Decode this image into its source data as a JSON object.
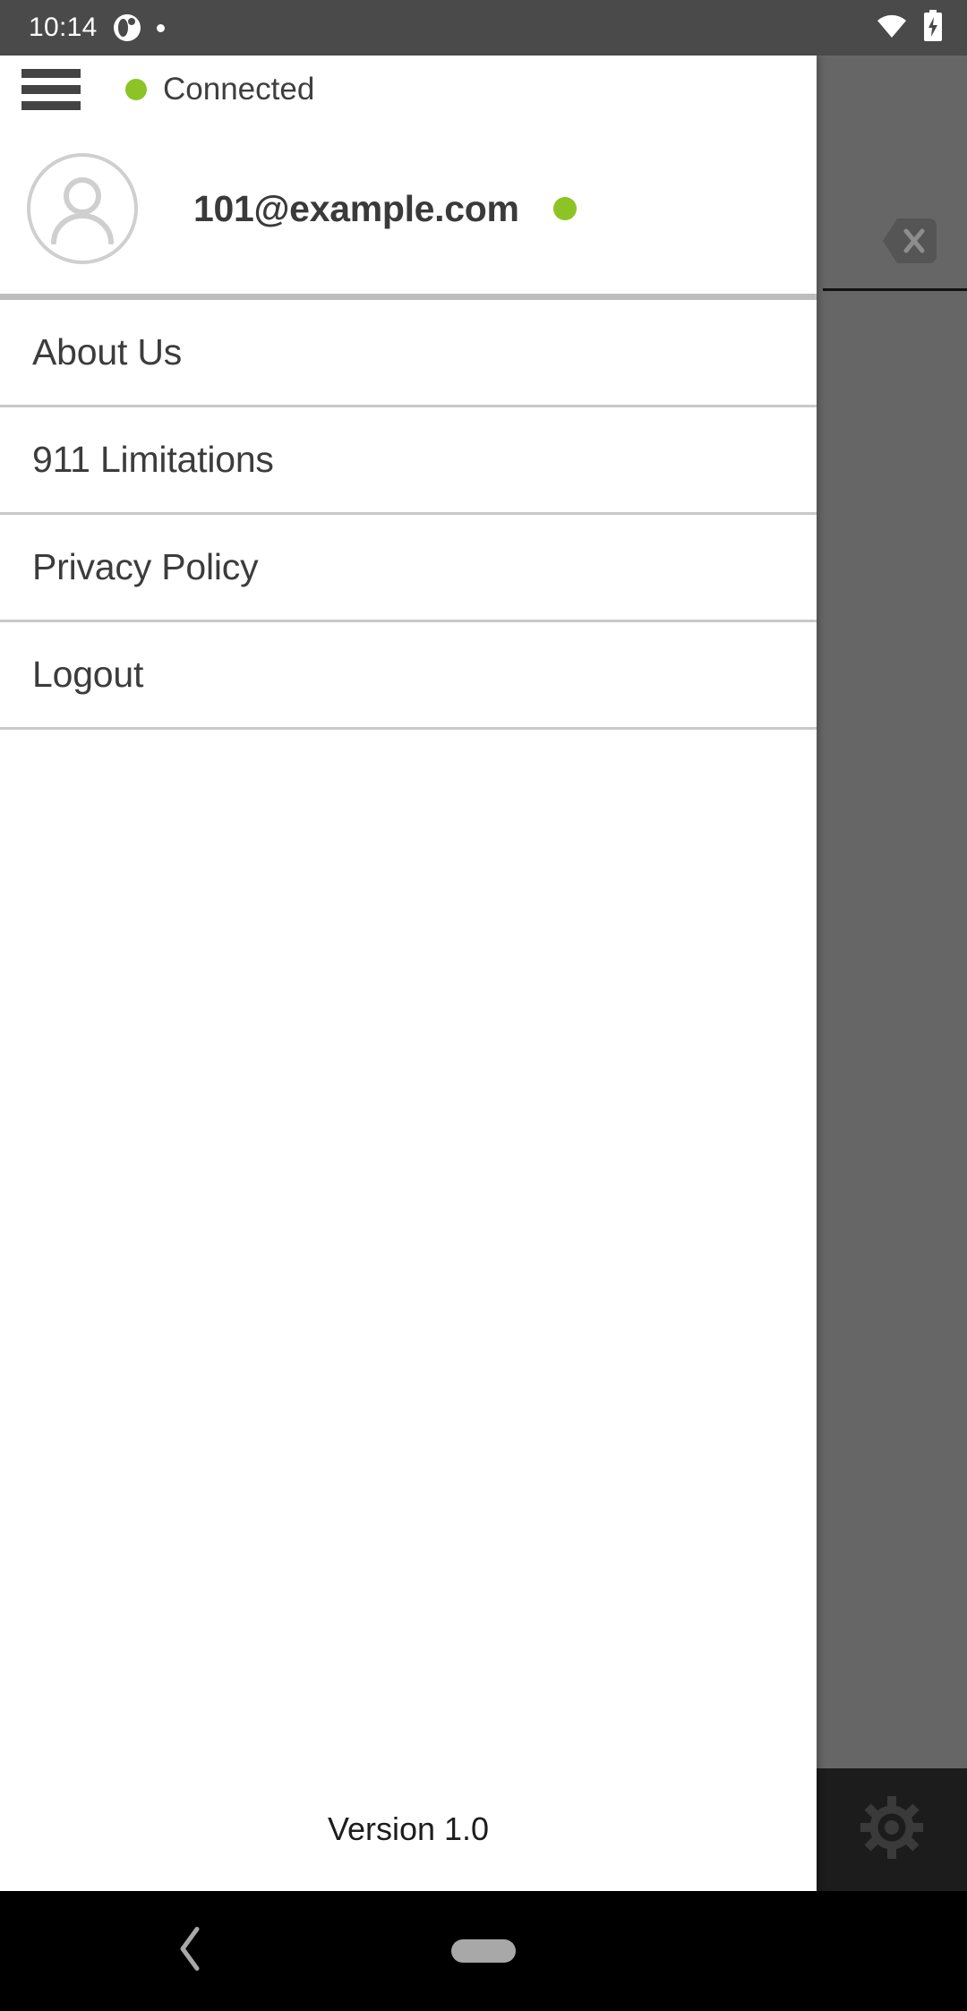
{
  "status_bar": {
    "clock": "10:14",
    "icons": [
      "app-circle-icon",
      "notification-dot-icon",
      "wifi-icon",
      "battery-charging-icon"
    ],
    "background_color": "#4a4a4a"
  },
  "drawer": {
    "header": {
      "menu_icon": "hamburger-icon",
      "connection_label": "Connected",
      "connection_dot_color": "#8cc425"
    },
    "profile": {
      "avatar_icon": "person-avatar-icon",
      "email": "101@example.com",
      "status_dot_color": "#8cc425"
    },
    "menu_items": [
      {
        "label": "About Us"
      },
      {
        "label": "911 Limitations"
      },
      {
        "label": "Privacy Policy"
      },
      {
        "label": "Logout"
      }
    ],
    "footer": {
      "version": "Version 1.0"
    }
  },
  "background": {
    "scrim_color": "#666666",
    "backspace_icon": "backspace-delete-icon",
    "settings_icon": "gear-icon",
    "settings_panel_color": "#1c1c1c"
  },
  "nav_bar": {
    "back_icon": "back-chevron-icon",
    "home_icon": "home-pill-icon",
    "background_color": "#000000"
  }
}
